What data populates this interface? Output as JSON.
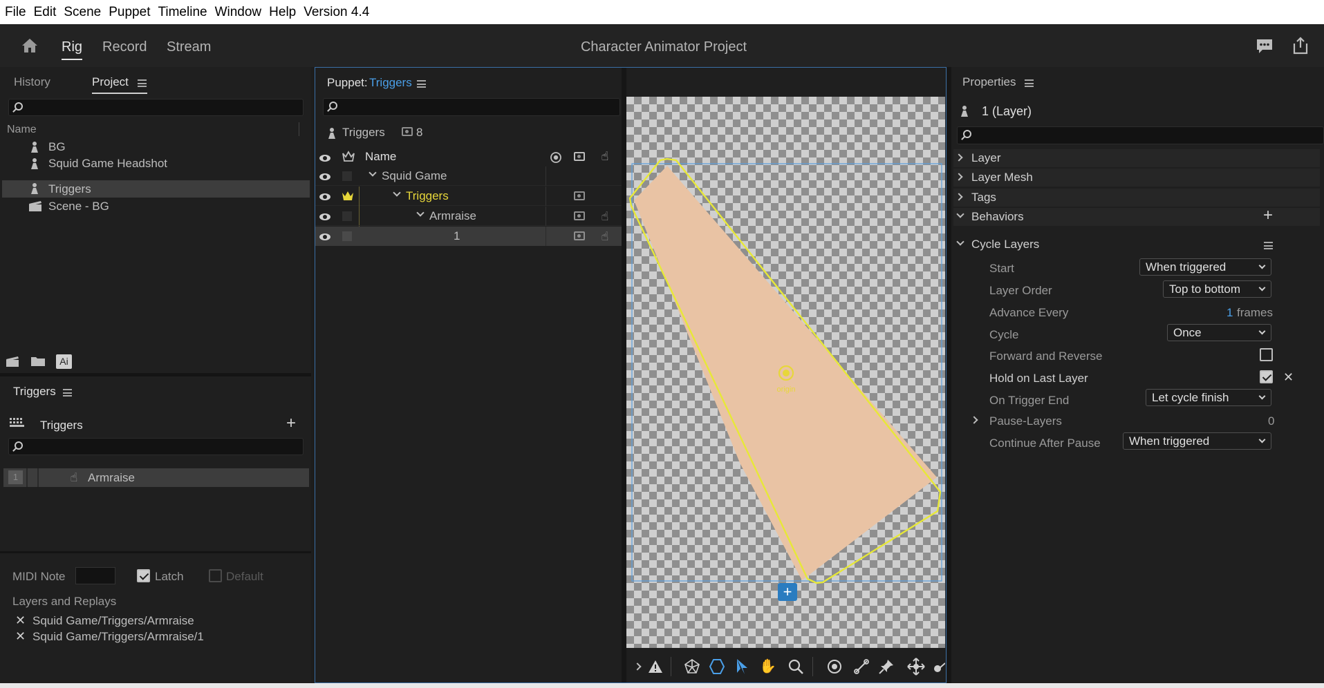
{
  "menubar": {
    "items": [
      "File",
      "Edit",
      "Scene",
      "Puppet",
      "Timeline",
      "Window",
      "Help",
      "Version 4.4"
    ]
  },
  "topbar": {
    "tabs": [
      "Rig",
      "Record",
      "Stream"
    ],
    "active_tab": "Rig",
    "title": "Character Animator Project"
  },
  "project_panel": {
    "tabs": [
      "History",
      "Project"
    ],
    "active_tab": "Project",
    "column_header": "Name",
    "items": [
      {
        "label": "BG",
        "icon": "puppet-icon"
      },
      {
        "label": "Squid Game Headshot",
        "icon": "puppet-icon"
      },
      {
        "label": "Triggers",
        "icon": "puppet-icon",
        "selected": true
      },
      {
        "label": "Scene - BG",
        "icon": "scene-icon"
      }
    ],
    "footer_ai": "Ai"
  },
  "triggers_panel": {
    "title": "Triggers",
    "list_header": "Triggers",
    "items": [
      {
        "key": "1",
        "label": "Armraise"
      }
    ],
    "midi_label": "MIDI Note",
    "latch_label": "Latch",
    "latch_checked": true,
    "default_label": "Default",
    "default_checked": false,
    "layers_label": "Layers and Replays",
    "layers": [
      "Squid Game/Triggers/Armraise",
      "Squid Game/Triggers/Armraise/1"
    ]
  },
  "puppet_panel": {
    "title_prefix": "Puppet:",
    "title_name": "Triggers",
    "puppet_label": "Triggers",
    "count": "8",
    "column_name": "Name",
    "layers": [
      {
        "label": "Squid Game",
        "indent": 0
      },
      {
        "label": "Triggers",
        "indent": 1,
        "highlight": true
      },
      {
        "label": "Armraise",
        "indent": 2
      },
      {
        "label": "1",
        "indent": 3,
        "selected": true
      }
    ],
    "origin_label": "origin"
  },
  "properties_panel": {
    "title": "Properties",
    "layer_title": "1 (Layer)",
    "sections": [
      "Layer",
      "Layer Mesh",
      "Tags",
      "Behaviors"
    ],
    "behavior_name": "Cycle Layers",
    "props": {
      "start_label": "Start",
      "start_value": "When triggered",
      "layer_order_label": "Layer Order",
      "layer_order_value": "Top to bottom",
      "advance_label": "Advance Every",
      "advance_value": "1",
      "advance_unit": "frames",
      "cycle_label": "Cycle",
      "cycle_value": "Once",
      "forward_label": "Forward and Reverse",
      "forward_checked": false,
      "hold_label": "Hold on Last Layer",
      "hold_checked": true,
      "trigger_end_label": "On Trigger End",
      "trigger_end_value": "Let cycle finish",
      "pause_label": "Pause-Layers",
      "pause_value": "0",
      "continue_label": "Continue After Pause",
      "continue_value": "When triggered"
    }
  },
  "colors": {
    "accent_blue": "#4a9fe8",
    "highlight_yellow": "#e7d73a",
    "skin": "#e9c3a4"
  }
}
